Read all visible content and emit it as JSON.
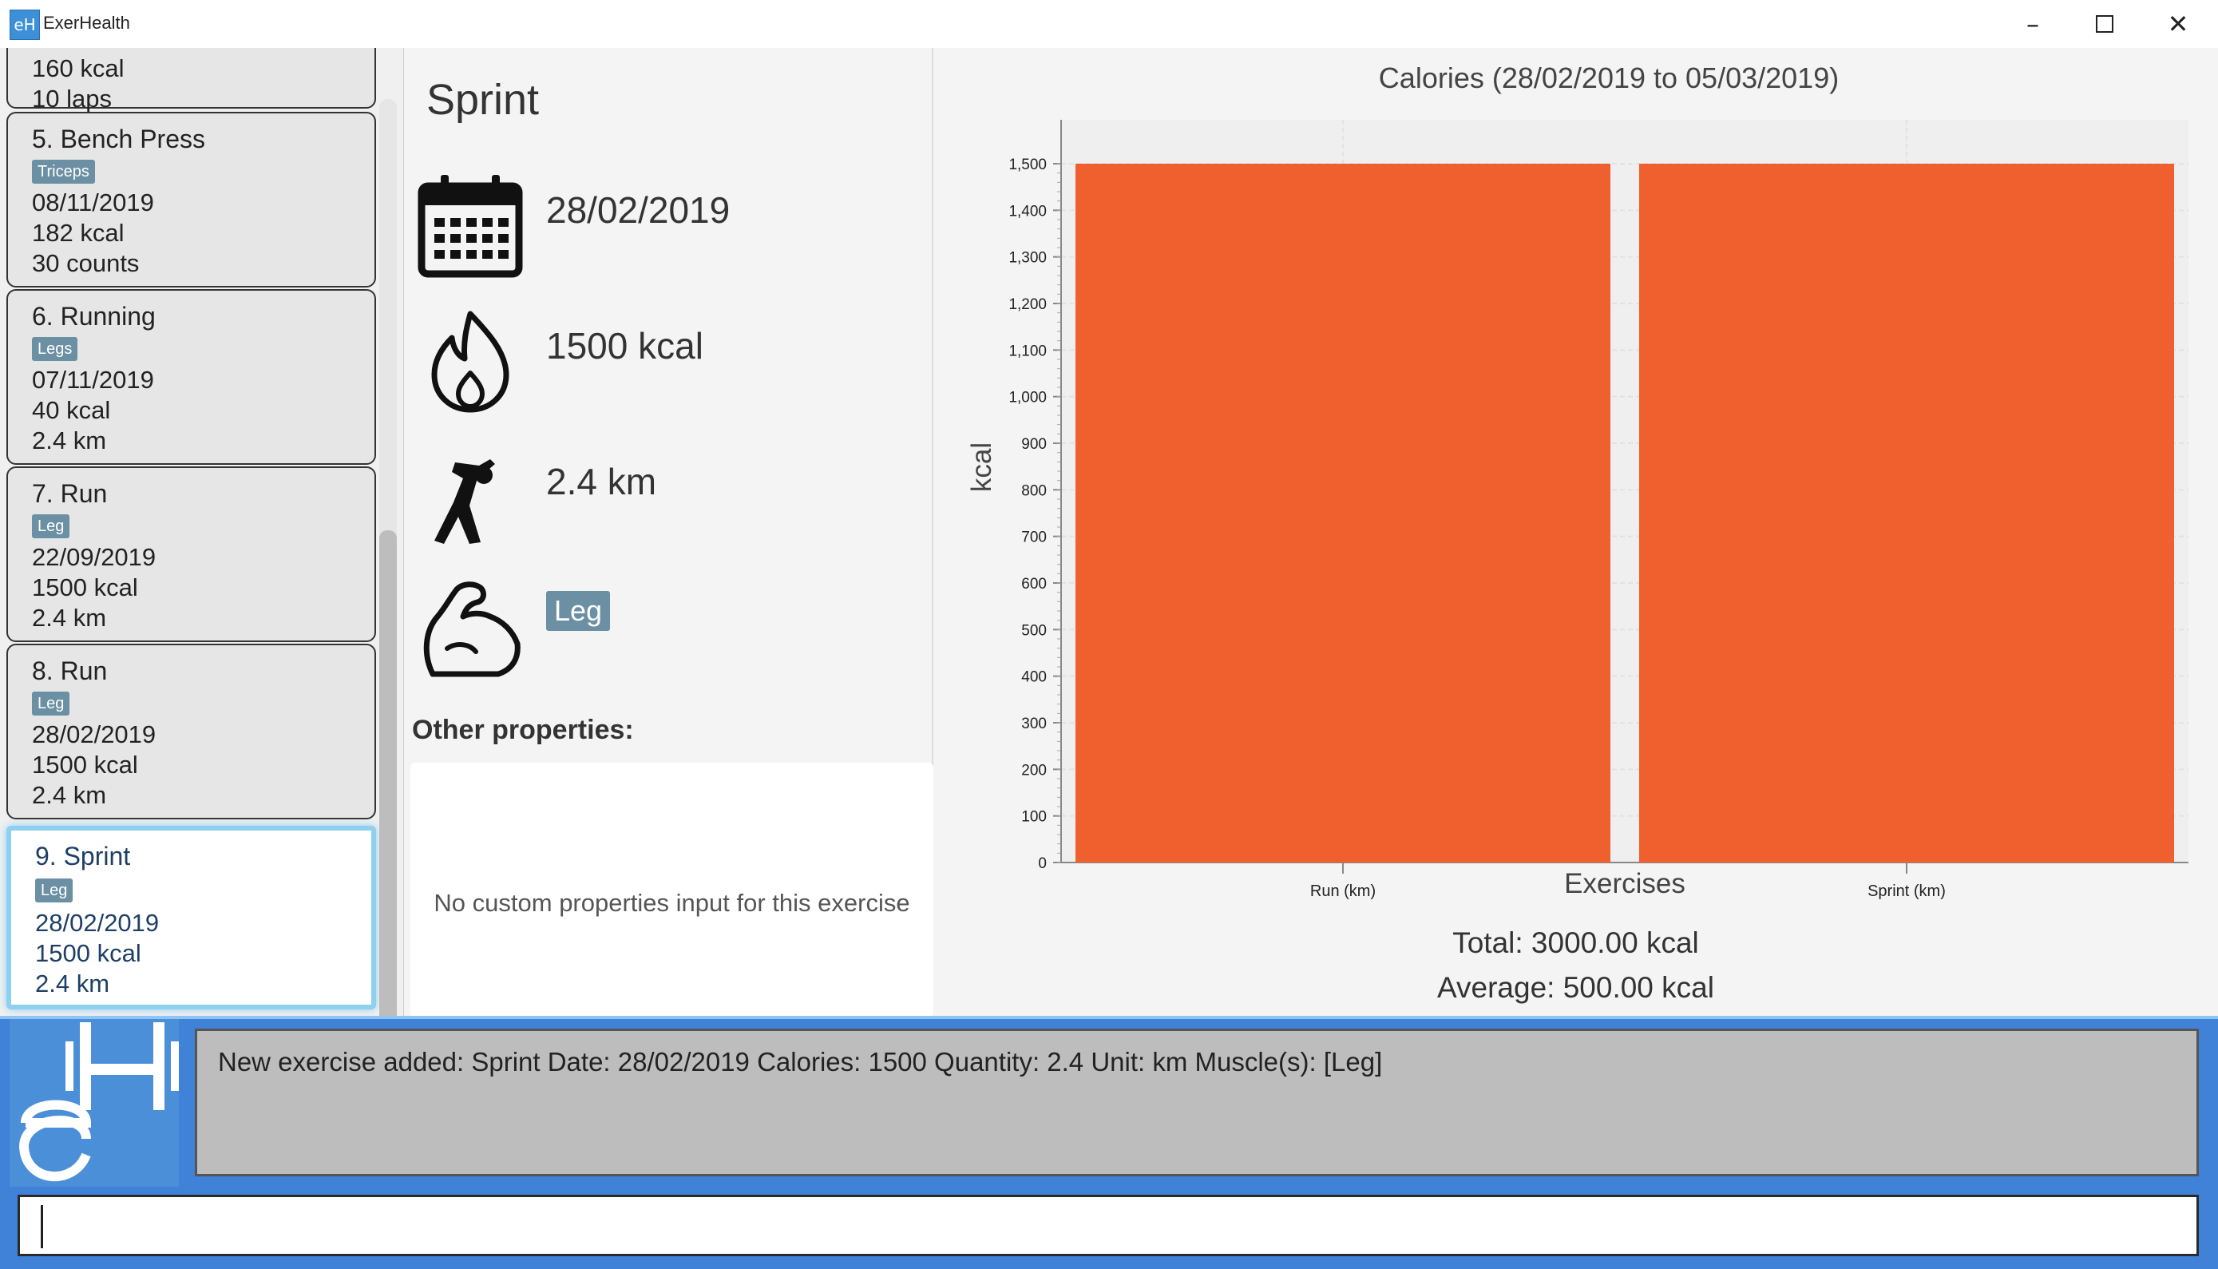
{
  "window": {
    "title": "ExerHealth",
    "icon_letter": "eH",
    "controls": [
      "minimize-icon",
      "maximize-icon",
      "close-icon"
    ]
  },
  "exercise_list": [
    {
      "partial": true,
      "lines": [
        "160 kcal",
        "10 laps"
      ]
    },
    {
      "title": "5.  Bench Press",
      "muscle": "Triceps",
      "date": "08/11/2019",
      "calories": "182 kcal",
      "quantity": "30 counts"
    },
    {
      "title": "6.  Running",
      "muscle": "Legs",
      "date": "07/11/2019",
      "calories": "40 kcal",
      "quantity": "2.4 km"
    },
    {
      "title": "7.  Run",
      "muscle": "Leg",
      "date": "22/09/2019",
      "calories": "1500 kcal",
      "quantity": "2.4 km"
    },
    {
      "title": "8.  Run",
      "muscle": "Leg",
      "date": "28/02/2019",
      "calories": "1500 kcal",
      "quantity": "2.4 km"
    },
    {
      "title": "9.  Sprint",
      "muscle": "Leg",
      "date": "28/02/2019",
      "calories": "1500 kcal",
      "quantity": "2.4 km",
      "selected": true
    }
  ],
  "detail": {
    "name": "Sprint",
    "date": "28/02/2019",
    "calories": "1500 kcal",
    "quantity": "2.4 km",
    "muscle": "Leg",
    "icons": [
      "calendar-icon",
      "flame-icon",
      "stretch-figure-icon",
      "flexed-arm-icon"
    ],
    "other_properties_label": "Other properties:",
    "no_custom_properties": "No custom properties input for this exercise"
  },
  "chart_data": {
    "type": "bar",
    "title": "Calories (28/02/2019 to 05/03/2019)",
    "xlabel": "Exercises",
    "ylabel": "kcal",
    "categories": [
      "Run (km)",
      "Sprint (km)"
    ],
    "values": [
      1500,
      1500
    ],
    "ylim": [
      0,
      1500
    ],
    "yticks": [
      "0",
      "100",
      "200",
      "300",
      "400",
      "500",
      "600",
      "700",
      "800",
      "900",
      "1,000",
      "1,100",
      "1,200",
      "1,300",
      "1,400",
      "1,500"
    ],
    "bar_color": "#f0602e",
    "grid": true,
    "total": "Total: 3000.00 kcal",
    "average": "Average: 500.00 kcal"
  },
  "result_display": {
    "text": "New exercise added: Sprint Date: 28/02/2019 Calories: 1500 Quantity: 2.4 Unit: km Muscle(s): [Leg]"
  },
  "command_box": {
    "value": ""
  },
  "colors": {
    "accent": "#3f82d8",
    "tag": "#6b8fa3",
    "bar": "#f0602e"
  }
}
